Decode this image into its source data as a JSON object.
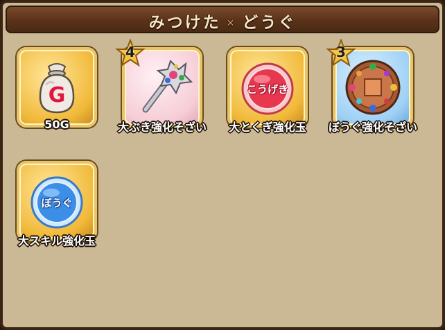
{
  "header": {
    "title_left": "みつけた",
    "title_right": "どうぐ",
    "separator": "✕"
  },
  "items": [
    {
      "label": "50G",
      "icon": "gold-bag-icon",
      "tile_color": "gold"
    },
    {
      "label": "大ぶき強化そざい",
      "icon": "gem-wand-icon",
      "tile_color": "pink",
      "badge": "4"
    },
    {
      "label": "大とくぎ強化玉",
      "icon": "skill-orb-icon",
      "tile_color": "gold",
      "orb_text": "こうげき"
    },
    {
      "label": "ぼうぐ強化そざい",
      "icon": "gem-shield-icon",
      "tile_color": "blue",
      "badge": "3"
    },
    {
      "label": "大スキル強化玉",
      "icon": "armor-orb-icon",
      "tile_color": "gold",
      "orb_text": "ぼうぐ"
    }
  ],
  "bag_letter": "G"
}
